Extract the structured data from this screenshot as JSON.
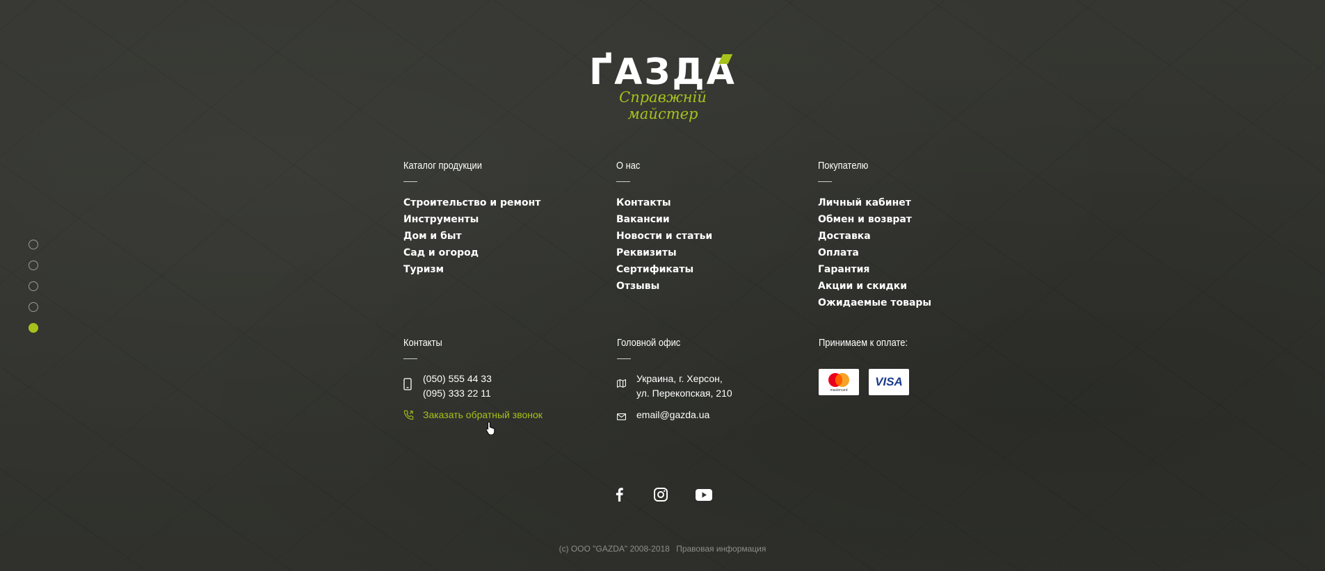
{
  "brand": {
    "name": "ҐАЗДА",
    "tagline": "Справжній майстер",
    "accent_color": "#a6c21b"
  },
  "slide_dots": {
    "count": 5,
    "active_index": 4
  },
  "catalog": {
    "title": "Каталог продукции",
    "items": [
      "Строительство и ремонт",
      "Инструменты",
      "Дом и быт",
      "Сад и огород",
      "Туризм"
    ]
  },
  "about": {
    "title": "О нас",
    "items": [
      "Контакты",
      "Вакансии",
      "Новости и статьи",
      "Реквизиты",
      "Сертификаты",
      "Отзывы"
    ]
  },
  "buyer": {
    "title": "Покупателю",
    "items": [
      "Личный кабинет",
      "Обмен и возврат",
      "Доставка",
      "Оплата",
      "Гарантия",
      "Акции и скидки",
      "Ожидаемые товары"
    ]
  },
  "contacts": {
    "title": "Контакты",
    "phone_1": "(050) 555 44 33",
    "phone_2": "(095) 333 22 11",
    "callback": "Заказать обратный звонок",
    "icons": [
      "mobile-phone-icon",
      "phone-callback-icon"
    ]
  },
  "office": {
    "title": "Головной офис",
    "address_1": "Украина, г. Херсон,",
    "address_2": "ул. Перекопская,  210",
    "email": "email@gazda.ua",
    "icons": [
      "map-icon",
      "mail-icon"
    ]
  },
  "payment": {
    "title": "Принимаем к оплате:",
    "mastercard_label": "mastercard",
    "visa_label": "VISA"
  },
  "social": [
    "facebook-icon",
    "instagram-icon",
    "youtube-icon"
  ],
  "footer": {
    "copyright": "(c) ООО \"GAZDA\" 2008-2018",
    "legal": "Правовая информация"
  }
}
